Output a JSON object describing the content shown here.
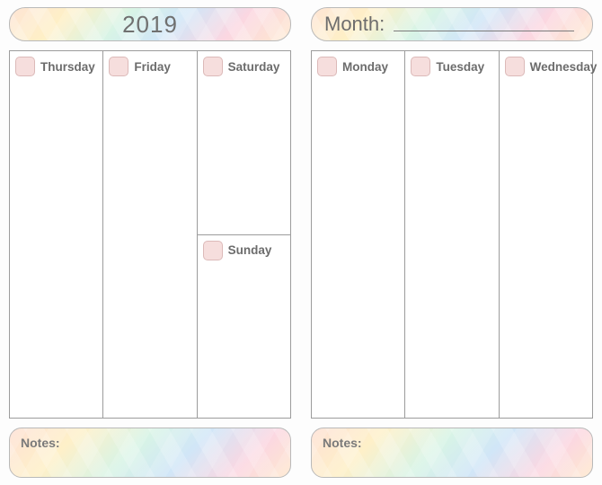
{
  "left": {
    "banner_year": "2019",
    "days": {
      "thu": "Thursday",
      "fri": "Friday",
      "sat": "Saturday",
      "sun": "Sunday"
    },
    "notes_label": "Notes:"
  },
  "right": {
    "month_label": "Month:",
    "month_value": "",
    "days": {
      "mon": "Monday",
      "tue": "Tuesday",
      "wed": "Wednesday"
    },
    "notes_label": "Notes:"
  }
}
